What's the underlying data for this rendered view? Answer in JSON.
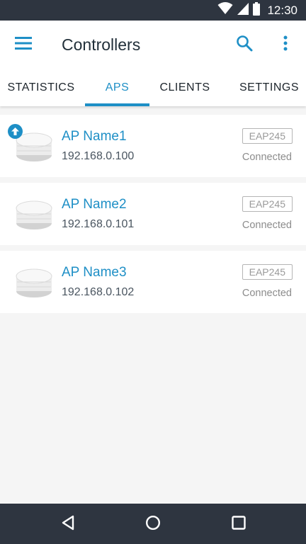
{
  "status_bar": {
    "time": "12:30",
    "icons": [
      "wifi-icon",
      "cell-signal-icon",
      "battery-icon"
    ]
  },
  "app_bar": {
    "title": "Controllers",
    "icons": [
      "menu-icon",
      "search-icon",
      "more-vert-icon"
    ]
  },
  "tabs": [
    {
      "label": "STATISTICS",
      "active": false
    },
    {
      "label": "APS",
      "active": true
    },
    {
      "label": "CLIENTS",
      "active": false
    },
    {
      "label": "SETTINGS",
      "active": false
    }
  ],
  "aps": [
    {
      "name": "AP Name1",
      "ip": "192.168.0.100",
      "model": "EAP245",
      "status": "Connected",
      "upgrade_available": true
    },
    {
      "name": "AP Name2",
      "ip": "192.168.0.101",
      "model": "EAP245",
      "status": "Connected",
      "upgrade_available": false
    },
    {
      "name": "AP Name3",
      "ip": "192.168.0.102",
      "model": "EAP245",
      "status": "Connected",
      "upgrade_available": false
    }
  ],
  "nav_bar": {
    "icons": [
      "back-icon",
      "home-icon",
      "recents-icon"
    ]
  },
  "colors": {
    "accent": "#1e8fc6",
    "system_bar": "#2e3540",
    "background": "#f5f5f5"
  }
}
